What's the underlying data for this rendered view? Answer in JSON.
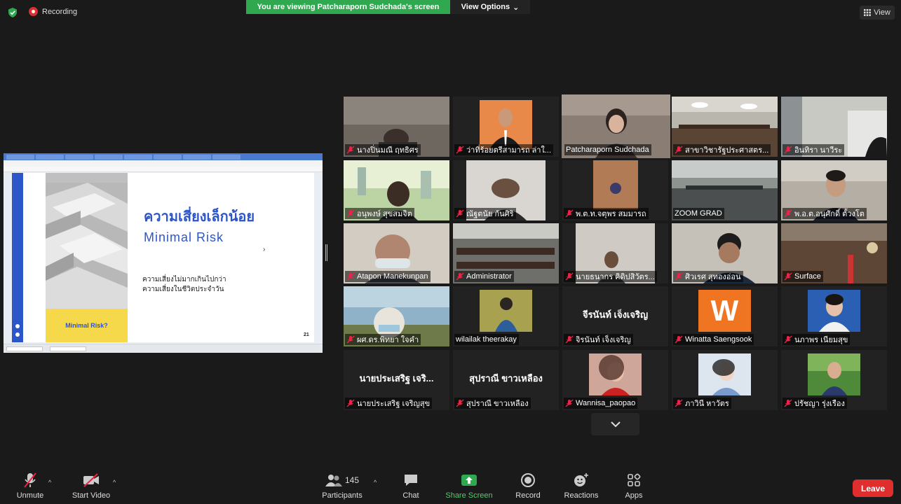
{
  "topbar": {
    "recording_label": "Recording",
    "viewing_banner": "You are viewing Patcharaporn Sudchada's screen",
    "view_options_label": "View Options",
    "view_label": "View"
  },
  "colors": {
    "accent_green": "#2fa84f",
    "active_speaker_border": "#c7e63e",
    "leave_red": "#e02d2d",
    "slide_blue": "#2c55c9"
  },
  "share": {
    "slide_title_th": "ความเสี่ยงเล็กน้อย",
    "slide_title_en": "Minimal Risk",
    "slide_line_1": "ความเสี่ยงไม่มากเกินไปกว่า",
    "slide_line_2": "ความเสี่ยงในชีวิตประจำวัน",
    "slide_box_label": "Minimal Risk?",
    "slide_page": "21"
  },
  "participants": [
    {
      "name": "นางปิ่นมณี ฤทธิศร",
      "kind": "video"
    },
    {
      "name": "ว่าที่ร้อยตรีสามารถ ล่าใ...",
      "kind": "video"
    },
    {
      "name": "Patcharaporn Sudchada",
      "kind": "video",
      "active": true
    },
    {
      "name": "สาขาวิชารัฐประศาสตร...",
      "kind": "video"
    },
    {
      "name": "อินทิรา นาวีระ",
      "kind": "video"
    },
    {
      "name": "อนุพงษ์ สุขสมจิต",
      "kind": "video"
    },
    {
      "name": "ณัฐตนัย กันศิริ",
      "kind": "video"
    },
    {
      "name": "พ.ต.ท.จตุพร สมมารถ",
      "kind": "video"
    },
    {
      "name": "ZOOM GRAD",
      "kind": "video"
    },
    {
      "name": "พ.อ.ต.อนุศักดิ์ ตั้วงโต",
      "kind": "video"
    },
    {
      "name": "Atapon Manekunpan",
      "kind": "video"
    },
    {
      "name": "Administrator",
      "kind": "video"
    },
    {
      "name": "นายธนากร คิดิปสิวัตร...",
      "kind": "video"
    },
    {
      "name": "ศิวเรศ สุทองอ่อน",
      "kind": "video"
    },
    {
      "name": "Surface",
      "kind": "video"
    },
    {
      "name": "ผศ.ดร.พิทยา ใจคำ",
      "kind": "video"
    },
    {
      "name": "wilailak theerakay",
      "kind": "photo"
    },
    {
      "name": "จิรนันท์ เจ็งเจริญ",
      "kind": "name",
      "center": "จีรนันท์ เจ็งเจริญ"
    },
    {
      "name": "Winatta Saengsook",
      "kind": "letter",
      "center": "W"
    },
    {
      "name": "นภาพร เนียมสุข",
      "kind": "photo"
    },
    {
      "name": "นายประเสริฐ เจริญสุข",
      "kind": "name",
      "center": "นายประเสริฐ เจริ..."
    },
    {
      "name": "สุปราณี ขาวเหลือง",
      "kind": "name",
      "center": "สุปราณี ขาวเหลือง"
    },
    {
      "name": "Wannisa_paopao",
      "kind": "photo"
    },
    {
      "name": "ภาวินี หาวัตร",
      "kind": "photo"
    },
    {
      "name": "ปรัชญา รุ่งเรือง",
      "kind": "photo"
    }
  ],
  "toolbar": {
    "unmute": "Unmute",
    "start_video": "Start Video",
    "participants_count": "145",
    "participants": "Participants",
    "chat": "Chat",
    "share_screen": "Share Screen",
    "record": "Record",
    "reactions": "Reactions",
    "apps": "Apps",
    "leave": "Leave"
  }
}
